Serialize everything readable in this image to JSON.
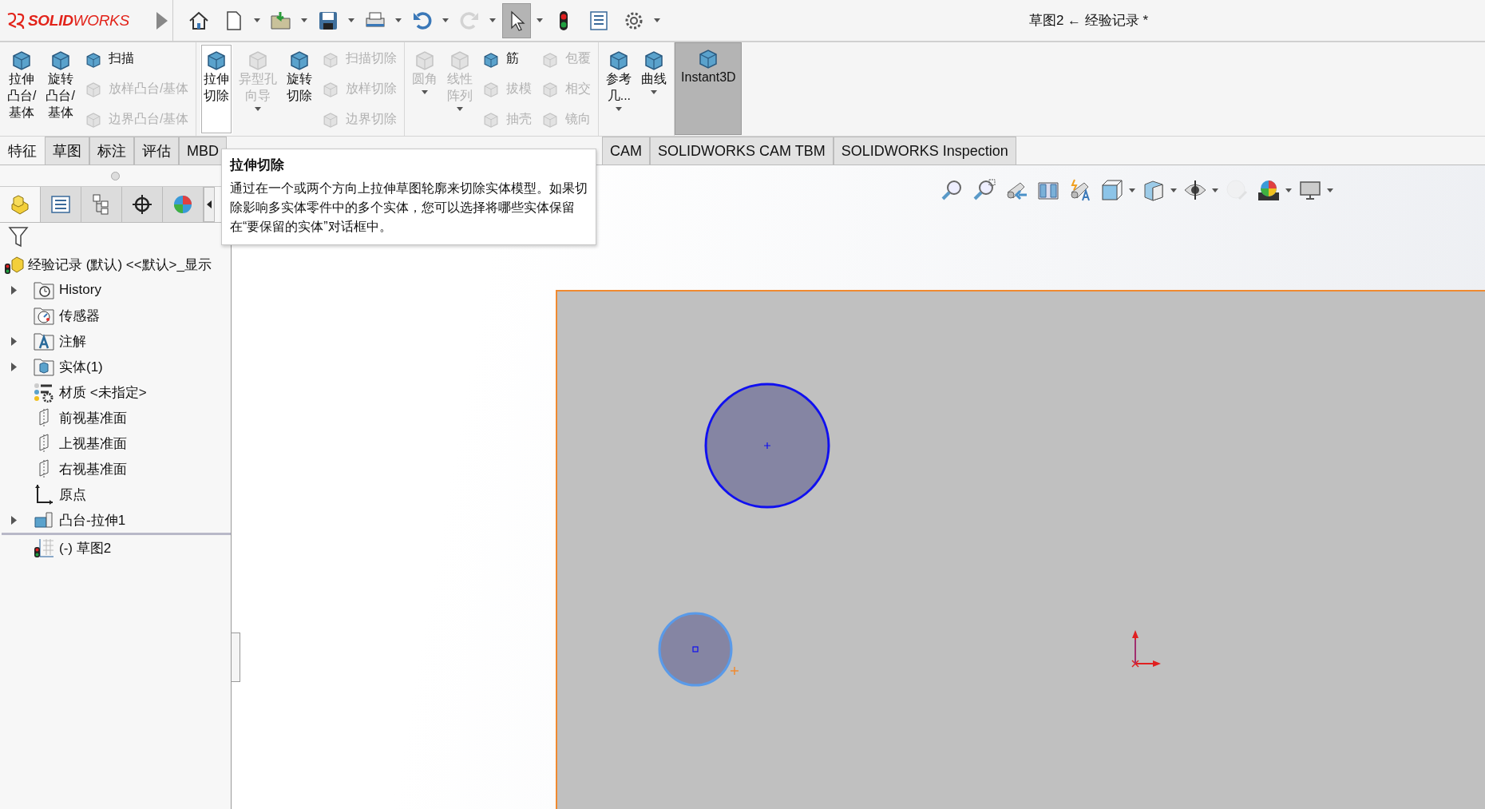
{
  "quick_access": {
    "logo": "**SOLID**WORKS",
    "buttons": [
      {
        "kind": "home",
        "dropdown": false,
        "disabled": false,
        "pressed": false
      },
      {
        "kind": "new",
        "dropdown": true,
        "disabled": false,
        "pressed": false
      },
      {
        "kind": "open",
        "dropdown": true,
        "disabled": false,
        "pressed": false
      },
      {
        "kind": "save",
        "dropdown": true,
        "disabled": false,
        "pressed": false
      },
      {
        "kind": "print",
        "dropdown": true,
        "disabled": false,
        "pressed": false
      },
      {
        "kind": "undo",
        "dropdown": true,
        "disabled": false,
        "pressed": false
      },
      {
        "kind": "redo",
        "dropdown": true,
        "disabled": true,
        "pressed": false
      },
      {
        "kind": "select",
        "dropdown": true,
        "disabled": false,
        "pressed": true
      },
      {
        "kind": "rebuild",
        "dropdown": false,
        "disabled": false,
        "pressed": false
      },
      {
        "kind": "list",
        "dropdown": false,
        "disabled": false,
        "pressed": false
      },
      {
        "kind": "settings",
        "dropdown": true,
        "disabled": false,
        "pressed": false
      }
    ]
  },
  "title": "草图2 ← 经验记录 *",
  "ribbon": {
    "groups": [
      {
        "items": [
          {
            "kind": "large",
            "lines": [
              "拉伸",
              "凸台/",
              "基体"
            ],
            "disabled": false,
            "hovered": false,
            "pressed": false,
            "dropdown": false
          },
          {
            "kind": "large",
            "lines": [
              "旋转",
              "凸台/",
              "基体"
            ],
            "disabled": false,
            "hovered": false,
            "pressed": false,
            "dropdown": false
          },
          {
            "kind": "stack",
            "items": [
              {
                "label": "扫描",
                "disabled": false
              },
              {
                "label": "放样凸台/基体",
                "disabled": true
              },
              {
                "label": "边界凸台/基体",
                "disabled": true
              }
            ]
          }
        ]
      },
      {
        "items": [
          {
            "kind": "large",
            "lines": [
              "拉伸",
              "切除"
            ],
            "disabled": false,
            "hovered": true,
            "pressed": false,
            "dropdown": false
          },
          {
            "kind": "large",
            "lines": [
              "异型孔",
              "向导"
            ],
            "disabled": true,
            "hovered": false,
            "pressed": false,
            "dropdown": true
          },
          {
            "kind": "large",
            "lines": [
              "旋转",
              "切除"
            ],
            "disabled": false,
            "hovered": false,
            "pressed": false,
            "dropdown": false
          },
          {
            "kind": "stack",
            "items": [
              {
                "label": "扫描切除",
                "disabled": true
              },
              {
                "label": "放样切除",
                "disabled": true
              },
              {
                "label": "边界切除",
                "disabled": true
              }
            ]
          }
        ]
      },
      {
        "items": [
          {
            "kind": "large",
            "lines": [
              "圆角"
            ],
            "disabled": true,
            "hovered": false,
            "pressed": false,
            "dropdown": true
          },
          {
            "kind": "large",
            "lines": [
              "线性",
              "阵列"
            ],
            "disabled": true,
            "hovered": false,
            "pressed": false,
            "dropdown": true
          },
          {
            "kind": "stack",
            "items": [
              {
                "label": "筋",
                "disabled": false
              },
              {
                "label": "拔模",
                "disabled": true
              },
              {
                "label": "抽壳",
                "disabled": true
              }
            ]
          },
          {
            "kind": "stack",
            "items": [
              {
                "label": "包覆",
                "disabled": true
              },
              {
                "label": "相交",
                "disabled": true
              },
              {
                "label": "镜向",
                "disabled": true
              }
            ]
          }
        ]
      },
      {
        "items": [
          {
            "kind": "large",
            "lines": [
              "参考",
              "几..."
            ],
            "disabled": false,
            "hovered": false,
            "pressed": false,
            "dropdown": true
          },
          {
            "kind": "large",
            "lines": [
              "曲线"
            ],
            "disabled": false,
            "hovered": false,
            "pressed": false,
            "dropdown": true
          }
        ]
      },
      {
        "items": [
          {
            "kind": "large",
            "lines": [
              "Instant3D"
            ],
            "disabled": false,
            "hovered": false,
            "pressed": true,
            "dropdown": false
          }
        ]
      }
    ]
  },
  "tabs": [
    {
      "label": "特征",
      "selected": true
    },
    {
      "label": "草图",
      "selected": false
    },
    {
      "label": "标注",
      "selected": false
    },
    {
      "label": "评估",
      "selected": false
    },
    {
      "label": "MBD",
      "selected": false
    },
    {
      "label": "CAM",
      "selected": false
    },
    {
      "label": "SOLIDWORKS CAM TBM",
      "selected": false
    },
    {
      "label": "SOLIDWORKS Inspection",
      "selected": false
    }
  ],
  "tooltip": {
    "title": "拉伸切除",
    "text": "通过在一个或两个方向上拉伸草图轮廓来切除实体模型。如果切除影响多实体零件中的多个实体，您可以选择将哪些实体保留在“要保留的实体”对话框中。"
  },
  "panel_tabs": [
    {
      "kind": "feature-manager",
      "selected": true
    },
    {
      "kind": "property-manager",
      "selected": false
    },
    {
      "kind": "configuration-manager",
      "selected": false
    },
    {
      "kind": "dimxpert",
      "selected": false
    },
    {
      "kind": "display-manager",
      "selected": false
    }
  ],
  "tree": {
    "label": "经验记录 (默认) <<默认>_显示",
    "kind": "part",
    "children": [
      {
        "label": "History",
        "kind": "history",
        "collapsed": true
      },
      {
        "label": "传感器",
        "kind": "sensor",
        "collapsed": false
      },
      {
        "label": "注解",
        "kind": "annotation",
        "collapsed": true
      },
      {
        "label": "实体(1)",
        "kind": "body",
        "collapsed": true
      },
      {
        "label": "材质 <未指定>",
        "kind": "material",
        "collapsed": false
      },
      {
        "label": "前视基准面",
        "kind": "plane",
        "collapsed": false
      },
      {
        "label": "上视基准面",
        "kind": "plane",
        "collapsed": false
      },
      {
        "label": "右视基准面",
        "kind": "plane",
        "collapsed": false
      },
      {
        "label": "原点",
        "kind": "origin",
        "collapsed": false
      },
      {
        "label": "凸台-拉伸1",
        "kind": "extrude",
        "collapsed": true
      },
      {
        "label": "(-) 草图2",
        "kind": "sketch",
        "collapsed": false
      }
    ]
  },
  "view_toolbar": [
    {
      "kind": "zoom-fit",
      "dropdown": false,
      "disabled": false
    },
    {
      "kind": "zoom-area",
      "dropdown": false,
      "disabled": false
    },
    {
      "kind": "previous-view",
      "dropdown": false,
      "disabled": false
    },
    {
      "kind": "section-view",
      "dropdown": false,
      "disabled": false
    },
    {
      "kind": "dynamic-annotation",
      "dropdown": false,
      "disabled": false
    },
    {
      "kind": "view-orientation",
      "dropdown": true,
      "disabled": false
    },
    {
      "kind": "display-style",
      "dropdown": true,
      "disabled": false
    },
    {
      "kind": "hide-show",
      "dropdown": true,
      "disabled": false
    },
    {
      "kind": "appearance",
      "dropdown": false,
      "disabled": true
    },
    {
      "kind": "scene",
      "dropdown": true,
      "disabled": false
    },
    {
      "kind": "display",
      "dropdown": true,
      "disabled": false
    }
  ]
}
